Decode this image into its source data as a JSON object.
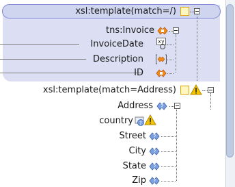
{
  "tree": {
    "template_root": {
      "label": "xsl:template(match=/)"
    },
    "invoice": {
      "label": "tns:Invoice"
    },
    "invoice_date": {
      "label": "InvoiceDate",
      "icon_text": "xy"
    },
    "description": {
      "label": "Description"
    },
    "id": {
      "label": "ID"
    },
    "template_address": {
      "label": "xsl:template(match=Address)"
    },
    "address": {
      "label": "Address"
    },
    "country": {
      "label": "country"
    },
    "street": {
      "label": "Street"
    },
    "city": {
      "label": "City"
    },
    "state": {
      "label": "State"
    },
    "zip": {
      "label": "Zip"
    }
  },
  "colors": {
    "selection_band": "#dcdff3",
    "selected_border": "#7f86d8",
    "warning": "#f4c400",
    "template_icon": "#e3a300",
    "element_icon": "#f08a1a",
    "unknown_icon": "#7aa0e0"
  }
}
